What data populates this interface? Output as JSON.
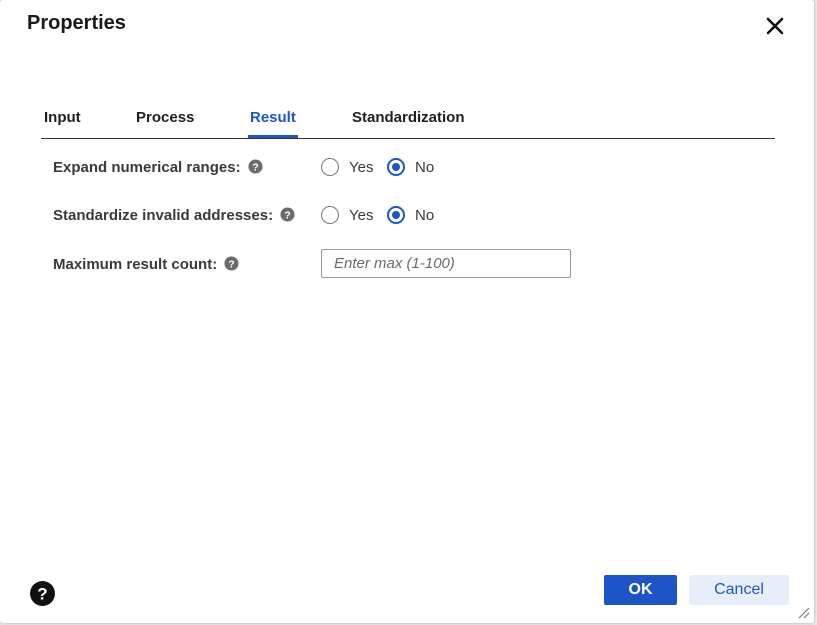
{
  "dialog": {
    "title": "Properties"
  },
  "tabs": [
    {
      "label": "Input",
      "active": false
    },
    {
      "label": "Process",
      "active": false
    },
    {
      "label": "Result",
      "active": true
    },
    {
      "label": "Standardization",
      "active": false
    }
  ],
  "fields": {
    "expand_ranges": {
      "label": "Expand numerical ranges:",
      "options": [
        "Yes",
        "No"
      ],
      "selected": "No"
    },
    "standardize_invalid": {
      "label": "Standardize invalid addresses:",
      "options": [
        "Yes",
        "No"
      ],
      "selected": "No"
    },
    "max_result": {
      "label": "Maximum result count:",
      "value": "",
      "placeholder": "Enter max (1-100)"
    }
  },
  "footer": {
    "ok_label": "OK",
    "cancel_label": "Cancel"
  },
  "icons": {
    "close": "close-icon",
    "help": "help-icon",
    "resize": "resize-grip-icon"
  },
  "colors": {
    "accent": "#1c55c7",
    "cancel_bg": "#e8eef9"
  }
}
